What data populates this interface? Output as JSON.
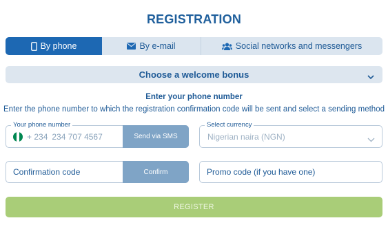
{
  "title": "REGISTRATION",
  "tabs": [
    {
      "label": "By phone",
      "icon": "phone-icon",
      "active": true
    },
    {
      "label": "By e-mail",
      "icon": "envelope-icon",
      "active": false
    },
    {
      "label": "Social networks and messengers",
      "icon": "users-icon",
      "active": false
    }
  ],
  "bonus": {
    "label": "Choose a welcome bonus",
    "icon": "chevron-down-icon"
  },
  "subtitle": "Enter your phone number",
  "description": "Enter the phone number to which the registration confirmation code will be sent and select a sending method",
  "phone": {
    "legend": "Your phone number",
    "country_code": "+ 234",
    "placeholder": "234 707 4567",
    "flag_colors": [
      "#008751",
      "#ffffff",
      "#008751"
    ],
    "send_button": "Send via SMS"
  },
  "currency": {
    "legend": "Select currency",
    "value": "Nigerian naira (NGN)",
    "icon": "chevron-down-icon"
  },
  "confirmation": {
    "placeholder": "Confirmation code",
    "button": "Confirm"
  },
  "promo": {
    "placeholder": "Promo code (if you have one)"
  },
  "register_button": "REGISTER",
  "colors": {
    "brand": "#1d68b3",
    "text": "#1e5a96",
    "muted_button": "#7fa4c6",
    "register": "#a9cd78",
    "tab_bg": "#dbe5ef"
  }
}
